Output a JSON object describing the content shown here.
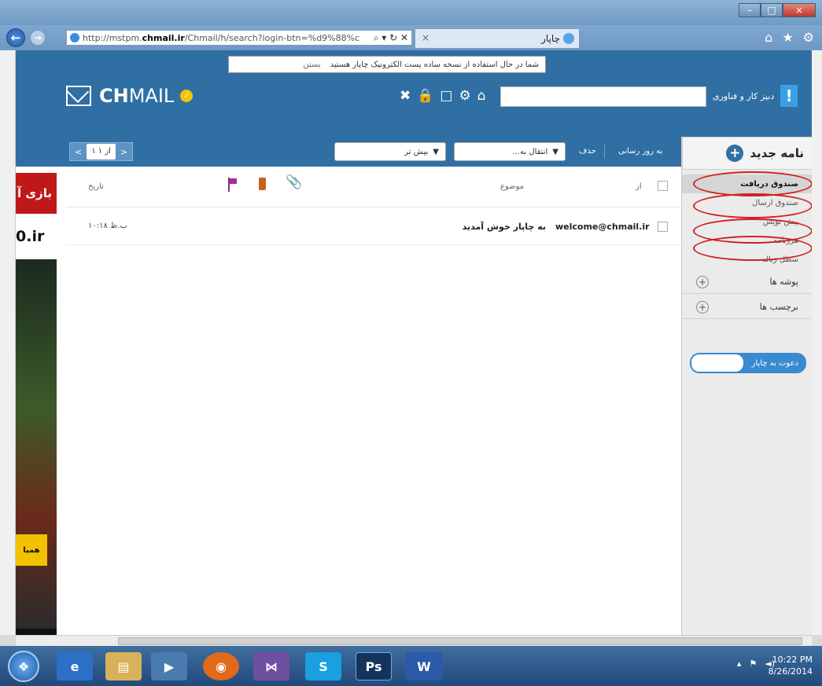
{
  "browser": {
    "address_url": "http://mstpm.",
    "address_host": "chmail.ir",
    "address_path": "/Chmail/h/search?login-btn=%d9%88%c",
    "address_tools": "⌕ ▾ ↻ ✕",
    "tab_title": "چاپار",
    "tab_close": "×",
    "window_minimize": "–",
    "window_maximize": "□",
    "window_close": "×",
    "tools": [
      "⌂",
      "★",
      "⚙"
    ]
  },
  "header": {
    "notice_text": "شما در حال استفاده از نسخه ساده پست الکترونیک چاپار هستید",
    "notice_close": "بستن",
    "logo_bold": "CH",
    "logo_thin": "MAIL",
    "brand_text": "دبیز کار و فناوری",
    "brand_mark": "!",
    "icons": [
      "✖",
      "🔒",
      "□",
      "⚙",
      "⌂"
    ]
  },
  "toolbar": {
    "prev": "<",
    "pager_count": "۱ از ۱",
    "next": ">",
    "more_select": "بیش تر",
    "move_select": "انتقال به...",
    "delete": "حذف",
    "refresh": "به روز رسانی",
    "select_arrow": "▼"
  },
  "sidebar": {
    "compose": "نامه جدید",
    "compose_icon": "+",
    "folders": [
      "صندوق دریافت",
      "صندوق ارسال",
      "پیش نویس",
      "هرزنامه",
      "سطل زباله"
    ],
    "sections": [
      {
        "label": "پوشه ها",
        "icon": "+"
      },
      {
        "label": "برچسب ها",
        "icon": "+"
      }
    ],
    "invite": "دعوت به چاپار"
  },
  "list": {
    "head_from": "از",
    "head_subject": "موضوع",
    "head_date": "تاریخ",
    "rows": [
      {
        "from": "welcome@chmail.ir",
        "subject": "به چاپار خوش آمدید",
        "date": "۱۰:۱۸ ب.ظ"
      }
    ]
  },
  "ad": {
    "top_text": "بازی آ",
    "domain": "0.ir",
    "badge": "همیا"
  },
  "taskbar": {
    "apps": [
      "e",
      "▤",
      "▶",
      "◉",
      "⋈",
      "S",
      "Ps",
      "W"
    ],
    "tray": [
      "▴",
      "⚑",
      "◄)"
    ],
    "time": "10:22 PM",
    "date": "8/26/2014"
  },
  "colors": {
    "header_blue": "#2f6fa3",
    "sidebar_gray": "#ebebeb",
    "annotation_red": "#d02020"
  }
}
